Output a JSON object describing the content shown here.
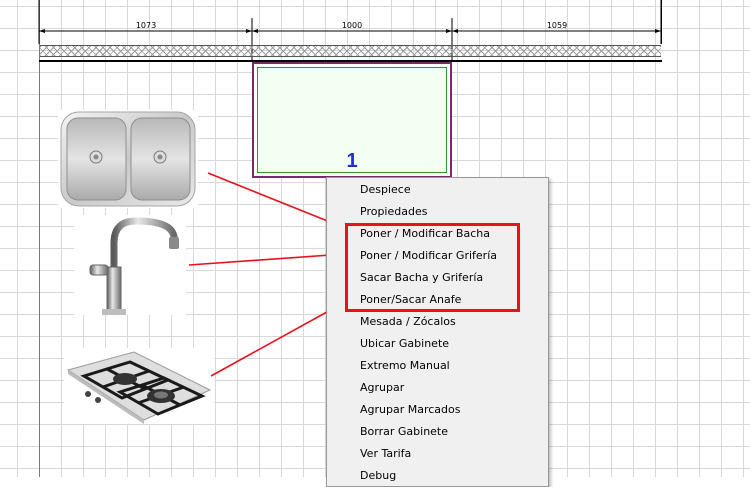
{
  "dimensions": {
    "segment_1": "1073",
    "segment_2": "1000",
    "segment_3": "1059"
  },
  "cabinet": {
    "number": "1"
  },
  "icons": {
    "sink": "double-sink-icon",
    "faucet": "faucet-icon",
    "cooktop": "gas-cooktop-icon"
  },
  "colors": {
    "highlight": "#e8121c",
    "connector": "#e8121c",
    "cabinet_border": "#7a2a6a",
    "cabinet_inner": "#2f9a2f",
    "cabinet_number": "#1f2fd0"
  },
  "context_menu": {
    "items": [
      "Despiece",
      "Propiedades",
      "Poner / Modificar Bacha",
      "Poner / Modificar Grifería",
      "Sacar Bacha y Grifería",
      "Poner/Sacar Anafe",
      "Mesada / Zócalos",
      "Ubicar Gabinete",
      "Extremo Manual",
      "Agrupar",
      "Agrupar Marcados",
      "Borrar Gabinete",
      "Ver Tarifa",
      "Debug"
    ]
  }
}
